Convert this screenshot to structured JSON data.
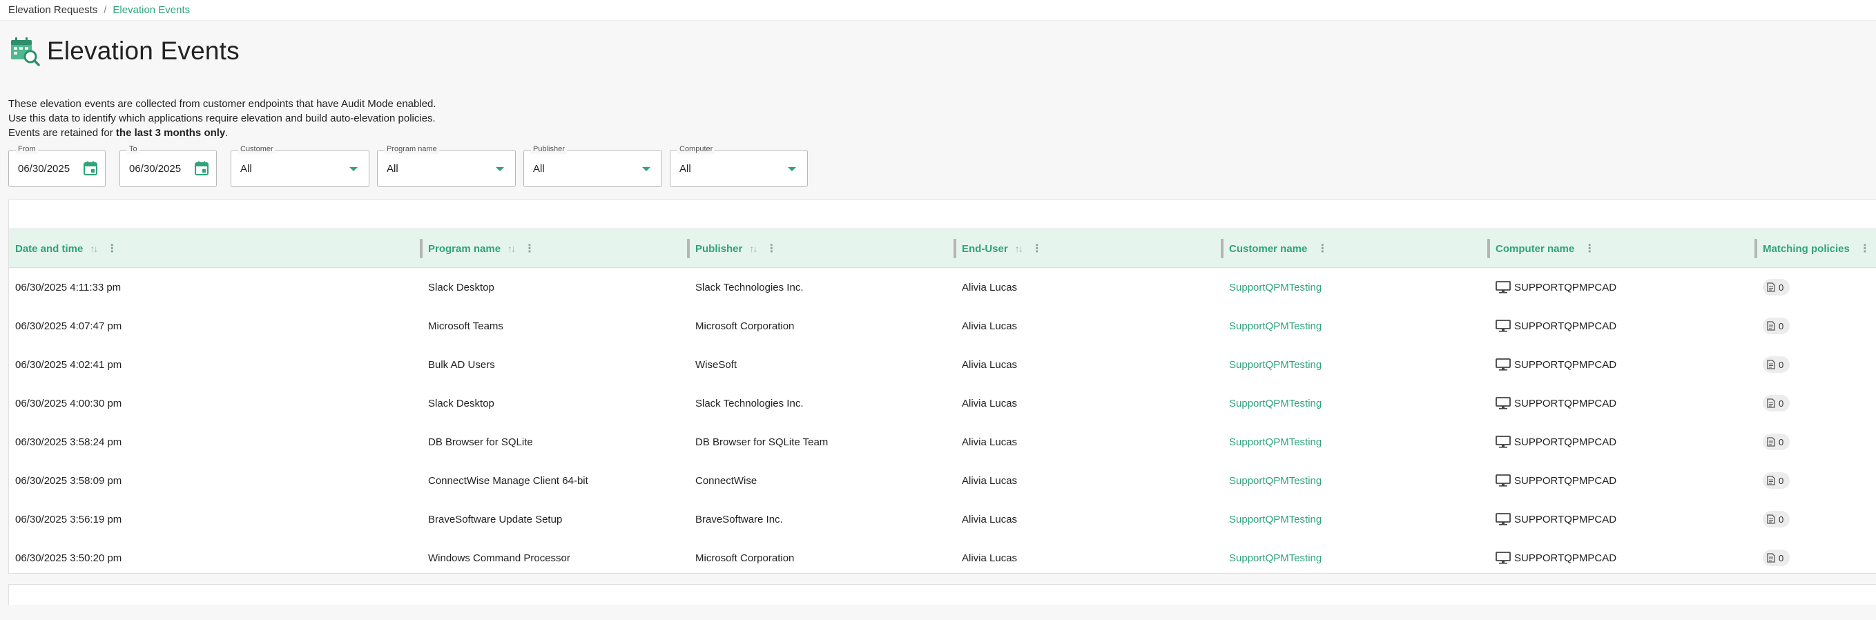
{
  "breadcrumb": {
    "parent": "Elevation Requests",
    "separator": "/",
    "current": "Elevation Events"
  },
  "page": {
    "title": "Elevation Events",
    "description_line1": "These elevation events are collected from customer endpoints that have Audit Mode enabled.",
    "description_line2": "Use this data to identify which applications require elevation and build auto-elevation policies.",
    "description_line3_prefix": "Events are retained for ",
    "description_line3_bold": "the last 3 months only",
    "description_line3_suffix": "."
  },
  "filters": {
    "from": {
      "label": "From",
      "value": "06/30/2025"
    },
    "to": {
      "label": "To",
      "value": "06/30/2025"
    },
    "customer": {
      "label": "Customer",
      "value": "All"
    },
    "program_name": {
      "label": "Program name",
      "value": "All"
    },
    "publisher": {
      "label": "Publisher",
      "value": "All"
    },
    "computer": {
      "label": "Computer",
      "value": "All"
    }
  },
  "table": {
    "columns": [
      "Date and time",
      "Program name",
      "Publisher",
      "End-User",
      "Customer name",
      "Computer name",
      "Matching policies"
    ],
    "rows": [
      {
        "date": "06/30/2025 4:11:33 pm",
        "program": "Slack Desktop",
        "publisher": "Slack Technologies Inc.",
        "user": "Alivia Lucas",
        "customer": "SupportQPMTesting",
        "computer": "SUPPORTQPMPCAD",
        "policies": "0"
      },
      {
        "date": "06/30/2025 4:07:47 pm",
        "program": "Microsoft Teams",
        "publisher": "Microsoft Corporation",
        "user": "Alivia Lucas",
        "customer": "SupportQPMTesting",
        "computer": "SUPPORTQPMPCAD",
        "policies": "0"
      },
      {
        "date": "06/30/2025 4:02:41 pm",
        "program": "Bulk AD Users",
        "publisher": "WiseSoft",
        "user": "Alivia Lucas",
        "customer": "SupportQPMTesting",
        "computer": "SUPPORTQPMPCAD",
        "policies": "0"
      },
      {
        "date": "06/30/2025 4:00:30 pm",
        "program": "Slack Desktop",
        "publisher": "Slack Technologies Inc.",
        "user": "Alivia Lucas",
        "customer": "SupportQPMTesting",
        "computer": "SUPPORTQPMPCAD",
        "policies": "0"
      },
      {
        "date": "06/30/2025 3:58:24 pm",
        "program": "DB Browser for SQLite",
        "publisher": "DB Browser for SQLite Team",
        "user": "Alivia Lucas",
        "customer": "SupportQPMTesting",
        "computer": "SUPPORTQPMPCAD",
        "policies": "0"
      },
      {
        "date": "06/30/2025 3:58:09 pm",
        "program": "ConnectWise Manage Client 64-bit",
        "publisher": "ConnectWise",
        "user": "Alivia Lucas",
        "customer": "SupportQPMTesting",
        "computer": "SUPPORTQPMPCAD",
        "policies": "0"
      },
      {
        "date": "06/30/2025 3:56:19 pm",
        "program": "BraveSoftware Update Setup",
        "publisher": "BraveSoftware Inc.",
        "user": "Alivia Lucas",
        "customer": "SupportQPMTesting",
        "computer": "SUPPORTQPMPCAD",
        "policies": "0"
      },
      {
        "date": "06/30/2025 3:50:20 pm",
        "program": "Windows Command Processor",
        "publisher": "Microsoft Corporation",
        "user": "Alivia Lucas",
        "customer": "SupportQPMTesting",
        "computer": "SUPPORTQPMPCAD",
        "policies": "0"
      }
    ]
  },
  "colors": {
    "accent": "#2fa37a",
    "header_bg": "#e6f4ee"
  },
  "icons": {
    "title": "calendar-search-icon",
    "date_picker": "calendar-icon",
    "dropdown": "chevron-down-icon",
    "computer": "monitor-icon",
    "policy": "document-icon"
  }
}
